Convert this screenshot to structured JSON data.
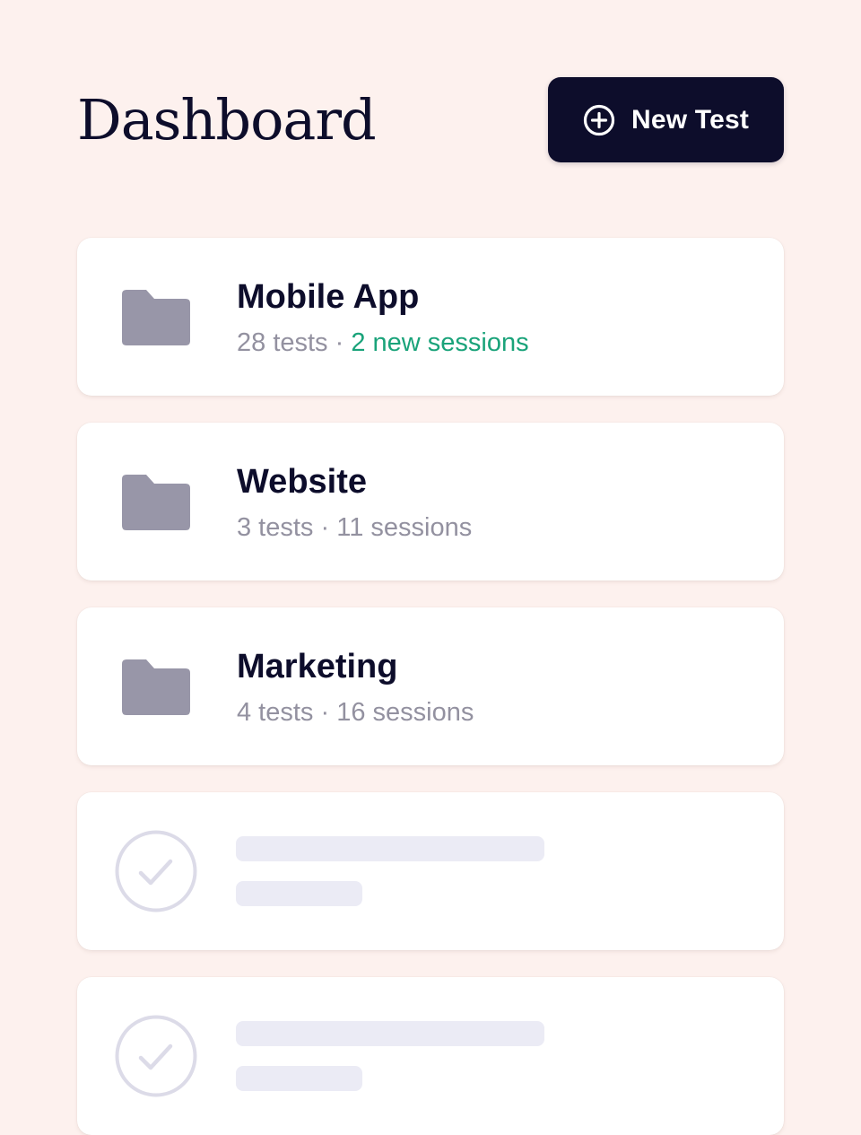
{
  "header": {
    "title": "Dashboard",
    "new_test_label": "New Test",
    "new_test_icon": "plus-circle-icon"
  },
  "projects": [
    {
      "name": "Mobile App",
      "tests": "28 tests",
      "separator": " · ",
      "sessions": "2 new sessions",
      "sessions_highlighted": true,
      "icon": "folder-icon"
    },
    {
      "name": "Website",
      "tests": "3 tests",
      "separator": " · ",
      "sessions": "11 sessions",
      "sessions_highlighted": false,
      "icon": "folder-icon"
    },
    {
      "name": "Marketing",
      "tests": "4 tests",
      "separator": " · ",
      "sessions": "16 sessions",
      "sessions_highlighted": false,
      "icon": "folder-icon"
    }
  ],
  "placeholder_cards": [
    {
      "icon": "check-circle-icon",
      "state": "loading"
    },
    {
      "icon": "check-circle-icon",
      "state": "loading"
    }
  ],
  "colors": {
    "background": "#fdf1ee",
    "primary_dark": "#0d0d2b",
    "card": "#ffffff",
    "folder": "#9896a8",
    "muted_text": "#9391a0",
    "success": "#1aa37a",
    "skeleton": "#ebebf5",
    "check_outline": "#dcdbe8"
  }
}
